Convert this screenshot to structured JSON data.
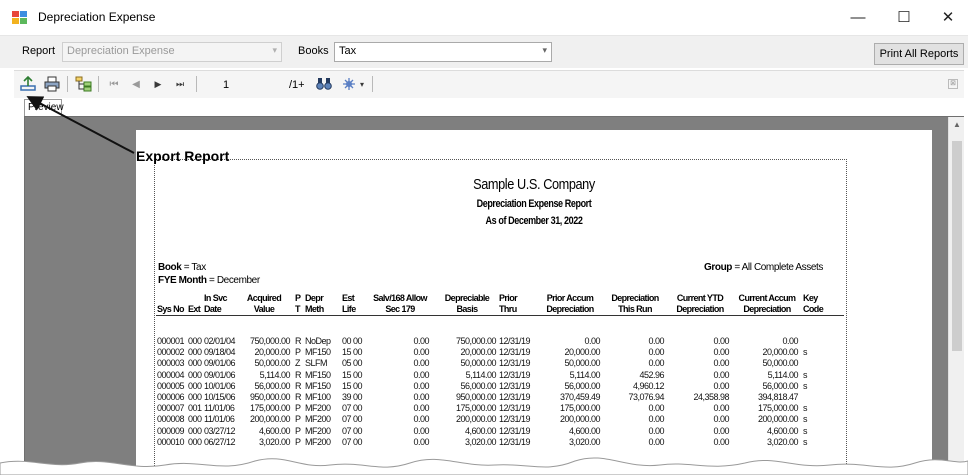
{
  "window": {
    "title": "Depreciation Expense",
    "minimize": "—",
    "maximize": "☐",
    "close": "✕"
  },
  "controls": {
    "report_label": "Report",
    "report_value": "Depreciation Expense",
    "books_label": "Books",
    "books_value": "Tax",
    "print_all": "Print All Reports"
  },
  "toolbar": {
    "page_value": "1",
    "page_count": "/1+",
    "close_glyph": "⊠"
  },
  "tab": {
    "label": "Preview"
  },
  "annotation": {
    "label": "Export Report"
  },
  "report": {
    "company": "Sample U.S. Company",
    "title": "Depreciation Expense Report",
    "as_of": "As of December 31, 2022",
    "book_label": "Book",
    "book_value": "= Tax",
    "fye_label": "FYE Month",
    "fye_value": "= December",
    "group_label": "Group",
    "group_value": "= All Complete Assets",
    "headers": [
      [
        "",
        "Sys No"
      ],
      [
        "",
        "Ext"
      ],
      [
        "In Svc",
        "Date"
      ],
      [
        "Acquired",
        "Value"
      ],
      [
        "P",
        "T"
      ],
      [
        "Depr",
        "Meth"
      ],
      [
        "Est",
        "Life"
      ],
      [
        "Salv/168 Allow",
        "Sec 179"
      ],
      [
        "Depreciable",
        "Basis"
      ],
      [
        "Prior",
        "Thru"
      ],
      [
        "Prior Accum",
        "Depreciation"
      ],
      [
        "Depreciation",
        "This Run"
      ],
      [
        "Current YTD",
        "Depreciation"
      ],
      [
        "Current Accum",
        "Depreciation"
      ],
      [
        "Key",
        "Code"
      ]
    ],
    "rows": [
      [
        "000001",
        "000",
        "02/01/04",
        "750,000.00",
        "R",
        "NoDep",
        "00 00",
        "0.00",
        "750,000.00",
        "12/31/19",
        "0.00",
        "0.00",
        "0.00",
        "0.00",
        ""
      ],
      [
        "000002",
        "000",
        "09/18/04",
        "20,000.00",
        "P",
        "MF150",
        "15 00",
        "0.00",
        "20,000.00",
        "12/31/19",
        "20,000.00",
        "0.00",
        "0.00",
        "20,000.00",
        "s"
      ],
      [
        "000003",
        "000",
        "09/01/06",
        "50,000.00",
        "Z",
        "SLFM",
        "05 00",
        "0.00",
        "50,000.00",
        "12/31/19",
        "50,000.00",
        "0.00",
        "0.00",
        "50,000.00",
        ""
      ],
      [
        "000004",
        "000",
        "09/01/06",
        "5,114.00",
        "R",
        "MF150",
        "15 00",
        "0.00",
        "5,114.00",
        "12/31/19",
        "5,114.00",
        "452.96",
        "0.00",
        "5,114.00",
        "s"
      ],
      [
        "000005",
        "000",
        "10/01/06",
        "56,000.00",
        "R",
        "MF150",
        "15 00",
        "0.00",
        "56,000.00",
        "12/31/19",
        "56,000.00",
        "4,960.12",
        "0.00",
        "56,000.00",
        "s"
      ],
      [
        "000006",
        "000",
        "10/15/06",
        "950,000.00",
        "R",
        "MF100",
        "39 00",
        "0.00",
        "950,000.00",
        "12/31/19",
        "370,459.49",
        "73,076.94",
        "24,358.98",
        "394,818.47",
        ""
      ],
      [
        "000007",
        "001",
        "11/01/06",
        "175,000.00",
        "P",
        "MF200",
        "07 00",
        "0.00",
        "175,000.00",
        "12/31/19",
        "175,000.00",
        "0.00",
        "0.00",
        "175,000.00",
        "s"
      ],
      [
        "000008",
        "000",
        "11/01/06",
        "200,000.00",
        "P",
        "MF200",
        "07 00",
        "0.00",
        "200,000.00",
        "12/31/19",
        "200,000.00",
        "0.00",
        "0.00",
        "200,000.00",
        "s"
      ],
      [
        "000009",
        "000",
        "03/27/12",
        "4,600.00",
        "P",
        "MF200",
        "07 00",
        "0.00",
        "4,600.00",
        "12/31/19",
        "4,600.00",
        "0.00",
        "0.00",
        "4,600.00",
        "s"
      ],
      [
        "000010",
        "000",
        "06/27/12",
        "3,020.00",
        "P",
        "MF200",
        "07 00",
        "0.00",
        "3,020.00",
        "12/31/19",
        "3,020.00",
        "0.00",
        "0.00",
        "3,020.00",
        "s"
      ]
    ]
  }
}
